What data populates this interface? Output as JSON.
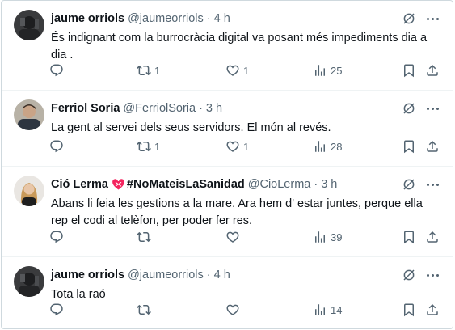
{
  "tweets": [
    {
      "name": "jaume orriols",
      "handle": "@jaumeorriols",
      "time": "4 h",
      "text": "És indignant com la burrocràcia digital va posant més impediments dia a dia .",
      "retweets": "1",
      "likes": "1",
      "views": "25"
    },
    {
      "name": "Ferriol Soria",
      "handle": "@FerriolSoria",
      "time": "3 h",
      "text": "La gent al servei dels seus servidors. El món al revés.",
      "retweets": "1",
      "likes": "1",
      "views": "28"
    },
    {
      "name": "Ció Lerma",
      "hashtag": "#NoMateisLaSanidad",
      "handle": "@CioLerma",
      "time": "3 h",
      "text": "Abans li feia les gestions a la mare. Ara hem d' estar juntes, perque ella rep el codi al telèfon, per poder fer res.",
      "retweets": "",
      "likes": "",
      "views": "39"
    },
    {
      "name": "jaume orriols",
      "handle": "@jaumeorriols",
      "time": "4 h",
      "text": "Tota la raó",
      "retweets": "",
      "likes": "",
      "views": "14"
    }
  ],
  "separator": "·",
  "icons": {
    "reply": "reply-icon",
    "retweet": "retweet-icon",
    "like": "heart-icon",
    "views": "views-icon",
    "bookmark": "bookmark-icon",
    "share": "share-icon",
    "grok": "grok-icon",
    "more": "more-icon"
  },
  "colors": {
    "text": "#0f1419",
    "secondary": "#536471",
    "border": "#cfd9de",
    "heart_emoji": "#f4245e"
  }
}
